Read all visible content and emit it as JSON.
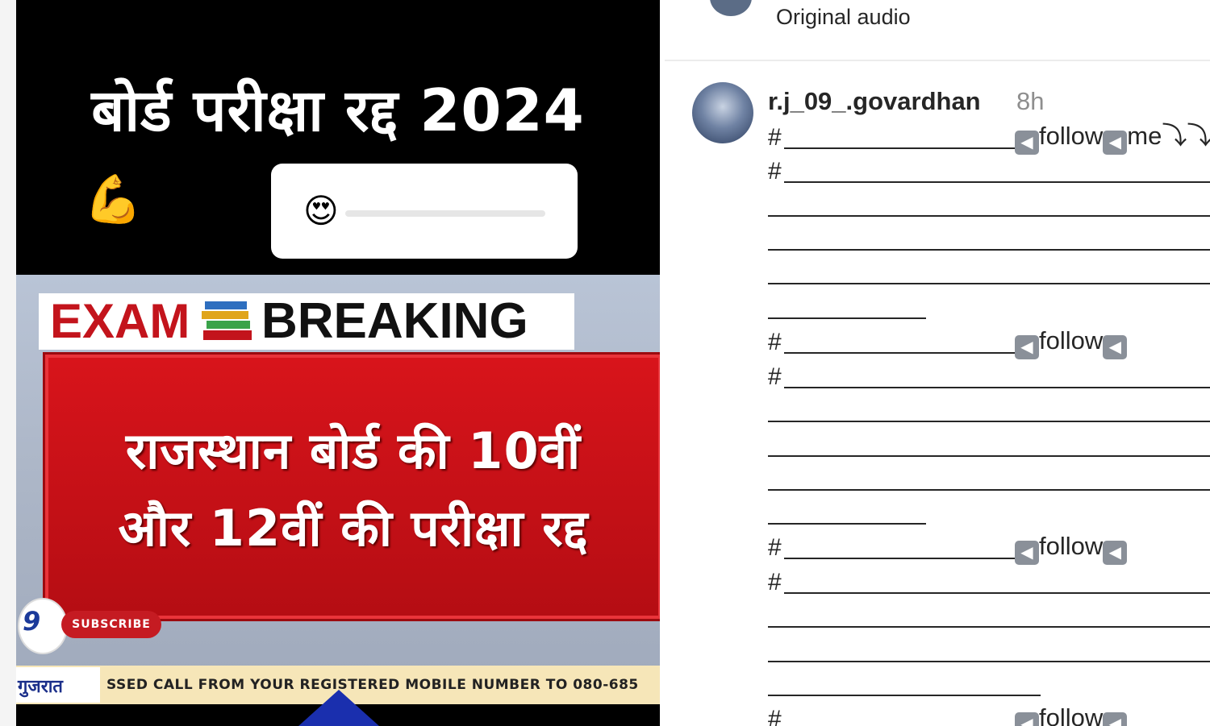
{
  "video": {
    "headline": "बोर्ड परीक्षा रद्द 2024",
    "emoji_row": "💪😍😍",
    "slider_emoji": "😍",
    "slider_value": 0.1,
    "banner_left": "EXAM",
    "banner_right": "BREAKING",
    "main_line1": "राजस्थान बोर्ड की 10वीं",
    "main_line2": "और 12वीं की परीक्षा रद्द",
    "channel_logo": "9",
    "subscribe": "SUBSCRIBE",
    "ticker_logo": "गुजरात",
    "ticker": "SSED CALL FROM YOUR REGISTERED MOBILE NUMBER TO 080-685"
  },
  "comments_panel": {
    "original_audio": "Original audio",
    "comment": {
      "username": "r.j_09_.govardhan",
      "time": "8h",
      "hash": "#",
      "follow_text": "follow",
      "follow_me_text": "me",
      "arrow_icon": "◀",
      "down_arrows": "⤵⤵"
    }
  },
  "colors": {
    "red": "#c3141c",
    "text": "#262626",
    "muted": "#8e8e8e"
  }
}
